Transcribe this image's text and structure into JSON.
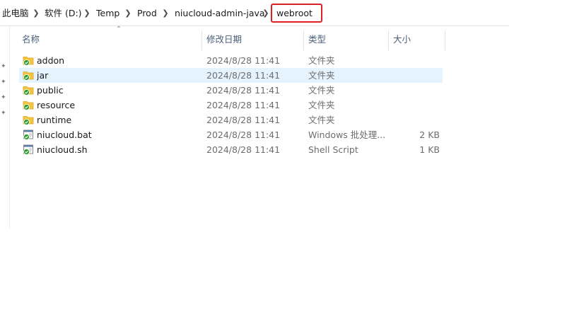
{
  "breadcrumb": {
    "items": [
      {
        "label": "此电脑"
      },
      {
        "label": "软件 (D:)"
      },
      {
        "label": "Temp"
      },
      {
        "label": "Prod"
      },
      {
        "label": "niucloud-admin-java"
      },
      {
        "label": "webroot"
      }
    ],
    "separator_icon": "chevron-right-icon",
    "highlight_color": "#e02020"
  },
  "columns": {
    "name": "名称",
    "date": "修改日期",
    "type": "类型",
    "size": "大小",
    "sort_icon": "sort-up-icon"
  },
  "files": [
    {
      "name": "addon",
      "date": "2024/8/28 11:41",
      "type": "文件夹",
      "size": "",
      "icon": "folder-synced-icon",
      "selected": false
    },
    {
      "name": "jar",
      "date": "2024/8/28 11:41",
      "type": "文件夹",
      "size": "",
      "icon": "folder-synced-icon",
      "selected": true
    },
    {
      "name": "public",
      "date": "2024/8/28 11:41",
      "type": "文件夹",
      "size": "",
      "icon": "folder-synced-icon",
      "selected": false
    },
    {
      "name": "resource",
      "date": "2024/8/28 11:41",
      "type": "文件夹",
      "size": "",
      "icon": "folder-synced-icon",
      "selected": false
    },
    {
      "name": "runtime",
      "date": "2024/8/28 11:41",
      "type": "文件夹",
      "size": "",
      "icon": "folder-synced-icon",
      "selected": false
    },
    {
      "name": "niucloud.bat",
      "date": "2024/8/28 11:41",
      "type": "Windows 批处理...",
      "size": "2 KB",
      "icon": "script-file-synced-icon",
      "selected": false
    },
    {
      "name": "niucloud.sh",
      "date": "2024/8/28 11:41",
      "type": "Shell Script",
      "size": "1 KB",
      "icon": "script-file-synced-icon",
      "selected": false
    }
  ],
  "colors": {
    "selection": "#e5f3ff",
    "header_text": "#4c607a",
    "sync_check": "#2a9d2a",
    "folder": "#f5c542"
  }
}
